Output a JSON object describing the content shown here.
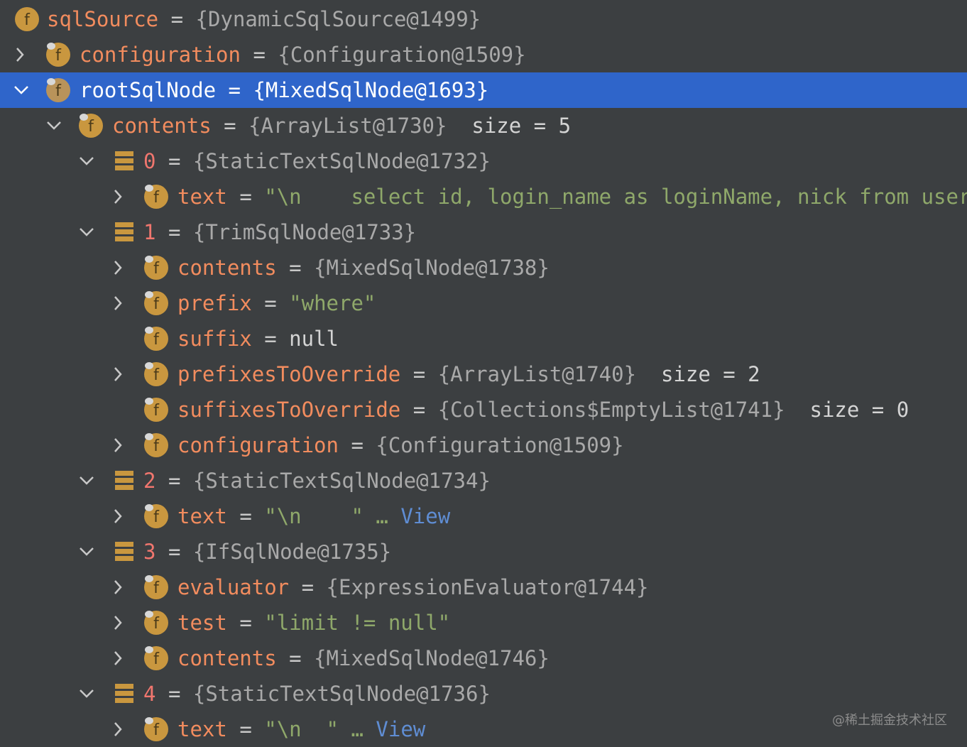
{
  "rows": [
    {
      "chevron": "none",
      "icon": "field-icon",
      "name": "sqlSource",
      "eq": "=",
      "value": "{DynamicSqlSource@1499}",
      "extra": ""
    },
    {
      "chevron": "collapsed",
      "icon": "field-icon",
      "name": "configuration",
      "eq": "=",
      "value": "{Configuration@1509}",
      "extra": ""
    },
    {
      "chevron": "expanded",
      "icon": "field-icon",
      "name": "rootSqlNode",
      "eq": "=",
      "value": "{MixedSqlNode@1693}",
      "extra": "",
      "selected": true
    },
    {
      "chevron": "expanded",
      "icon": "field-icon",
      "name": "contents",
      "eq": "=",
      "value": "{ArrayList@1730}",
      "extra": "size = 5"
    },
    {
      "chevron": "expanded",
      "icon": "array-element-icon",
      "name": "0",
      "eq": "=",
      "value": "{StaticTextSqlNode@1732}",
      "extra": ""
    },
    {
      "chevron": "collapsed",
      "icon": "field-icon",
      "name": "text",
      "eq": "=",
      "value": "",
      "extra": "",
      "string_parts": [
        "\"\\n    select id, login_name as loginName, nick from user\\n"
      ]
    },
    {
      "chevron": "expanded",
      "icon": "array-element-icon",
      "name": "1",
      "eq": "=",
      "value": "{TrimSqlNode@1733}",
      "extra": ""
    },
    {
      "chevron": "collapsed",
      "icon": "field-icon",
      "name": "contents",
      "eq": "=",
      "value": "{MixedSqlNode@1738}",
      "extra": ""
    },
    {
      "chevron": "collapsed",
      "icon": "field-icon",
      "name": "prefix",
      "eq": "=",
      "value": "",
      "extra": "",
      "string_value": "\"where\""
    },
    {
      "chevron": "none",
      "icon": "field-icon",
      "name": "suffix",
      "eq": "=",
      "value": "",
      "extra": "",
      "plain_value": "null"
    },
    {
      "chevron": "collapsed",
      "icon": "field-icon",
      "name": "prefixesToOverride",
      "eq": "=",
      "value": "{ArrayList@1740}",
      "extra": "size = 2"
    },
    {
      "chevron": "none",
      "icon": "field-icon",
      "name": "suffixesToOverride",
      "eq": "=",
      "value": "{Collections$EmptyList@1741}",
      "extra": "size = 0"
    },
    {
      "chevron": "collapsed",
      "icon": "field-icon",
      "name": "configuration",
      "eq": "=",
      "value": "{Configuration@1509}",
      "extra": ""
    },
    {
      "chevron": "expanded",
      "icon": "array-element-icon",
      "name": "2",
      "eq": "=",
      "value": "{StaticTextSqlNode@1734}",
      "extra": ""
    },
    {
      "chevron": "collapsed",
      "icon": "field-icon",
      "name": "text",
      "eq": "=",
      "value": "",
      "extra": "",
      "str_open": "\"\\n    \"",
      "ellipsis": "…",
      "view": "View"
    },
    {
      "chevron": "expanded",
      "icon": "array-element-icon",
      "name": "3",
      "eq": "=",
      "value": "{IfSqlNode@1735}",
      "extra": ""
    },
    {
      "chevron": "collapsed",
      "icon": "field-icon",
      "name": "evaluator",
      "eq": "=",
      "value": "{ExpressionEvaluator@1744}",
      "extra": ""
    },
    {
      "chevron": "collapsed",
      "icon": "field-icon",
      "name": "test",
      "eq": "=",
      "value": "",
      "extra": "",
      "string_value": "\"limit != null\""
    },
    {
      "chevron": "collapsed",
      "icon": "field-icon",
      "name": "contents",
      "eq": "=",
      "value": "{MixedSqlNode@1746}",
      "extra": ""
    },
    {
      "chevron": "expanded",
      "icon": "array-element-icon",
      "name": "4",
      "eq": "=",
      "value": "{StaticTextSqlNode@1736}",
      "extra": ""
    },
    {
      "chevron": "collapsed",
      "icon": "field-icon",
      "name": "text",
      "eq": "=",
      "value": "",
      "extra": "",
      "str_open": "\"\\n  \"",
      "ellipsis": "…",
      "view": "View"
    }
  ],
  "watermark": "@稀土掘金技术社区",
  "colors": {
    "background": "#3c3f41",
    "selection": "#2f65ca",
    "field_name": "#f28c5e",
    "index_name": "#f0766e",
    "string": "#8fa86a",
    "escape": "#d3a04d",
    "link": "#5f8dd3",
    "field_icon": "#c9973f",
    "array_icon": "#c9973f"
  }
}
